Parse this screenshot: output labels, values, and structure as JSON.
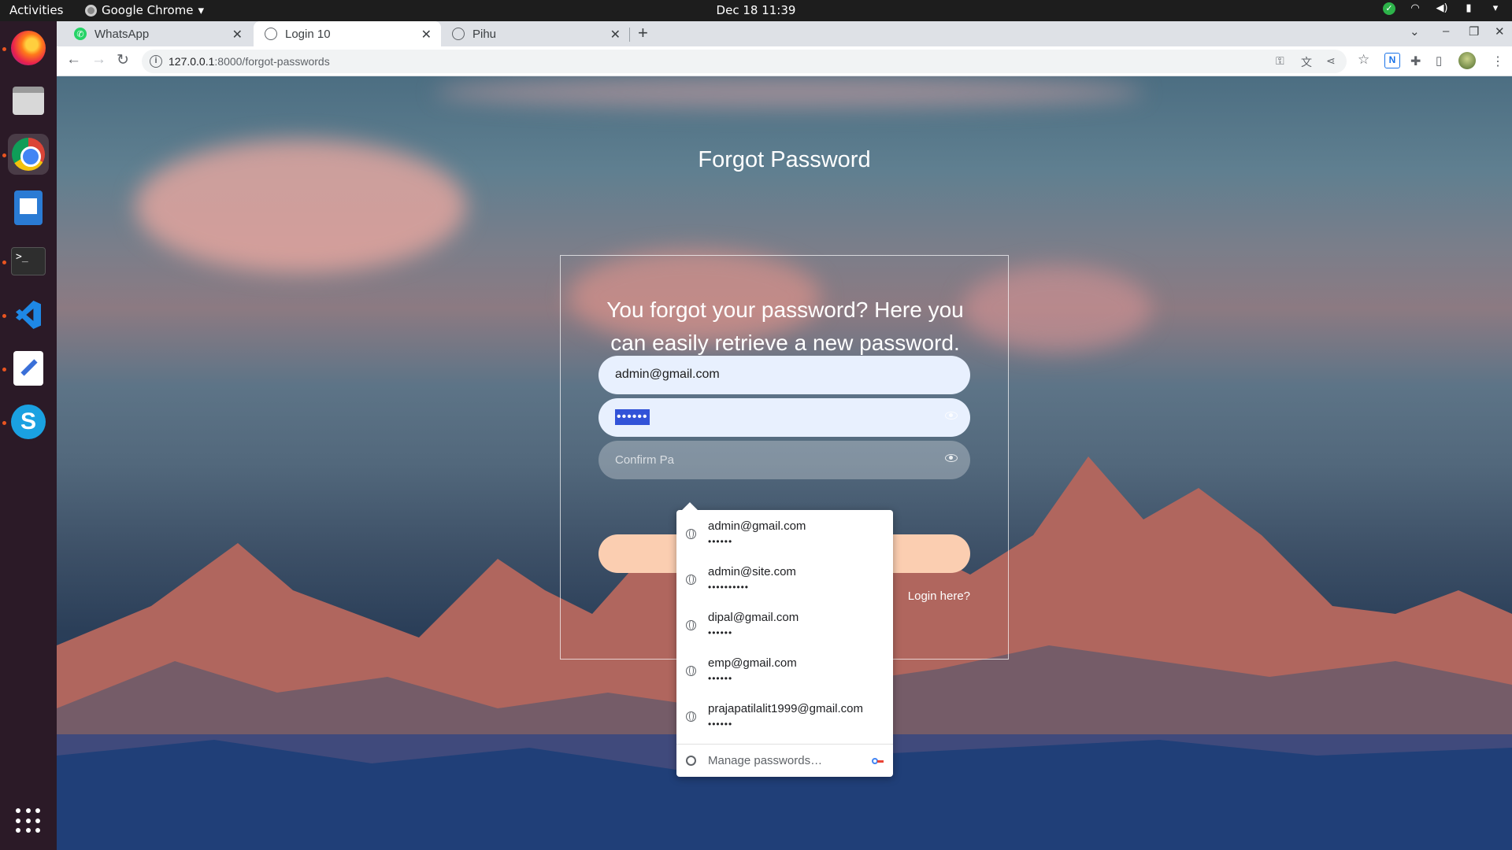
{
  "os": {
    "activities_label": "Activities",
    "app_menu_label": "Google Chrome",
    "clock": "Dec 18  11:39"
  },
  "dock": {
    "apps": [
      "firefox",
      "files",
      "google-chrome",
      "libreoffice-writer",
      "terminal",
      "vscode",
      "text-editor",
      "skype"
    ],
    "show_apps": "show-applications"
  },
  "browser": {
    "tabs": [
      {
        "title": "WhatsApp",
        "icon": "whatsapp-icon",
        "active": false
      },
      {
        "title": "Login 10",
        "icon": "globe-icon",
        "active": true
      },
      {
        "title": "Pihu",
        "icon": "globe-icon",
        "active": false
      }
    ],
    "url_host": "127.0.0.1",
    "url_path": ":8000/forgot-passwords"
  },
  "page": {
    "title": "Forgot Password",
    "lead": "You forgot your password? Here you can easily retrieve a new password.",
    "email_value": "admin@gmail.com",
    "password_value": "••••••",
    "confirm_placeholder": "Confirm Pa",
    "login_link": "Login here?"
  },
  "autofill": {
    "items": [
      {
        "user": "admin@gmail.com",
        "pass": "••••••"
      },
      {
        "user": "admin@site.com",
        "pass": "••••••••••"
      },
      {
        "user": "dipal@gmail.com",
        "pass": "••••••"
      },
      {
        "user": "emp@gmail.com",
        "pass": "••••••"
      },
      {
        "user": "prajapatilalit1999@gmail.com",
        "pass": "••••••"
      }
    ],
    "manage_label": "Manage passwords…"
  },
  "colors": {
    "submit_button": "#fbceb1",
    "field_bg": "#e8f0fe",
    "selection": "#3253d8"
  }
}
